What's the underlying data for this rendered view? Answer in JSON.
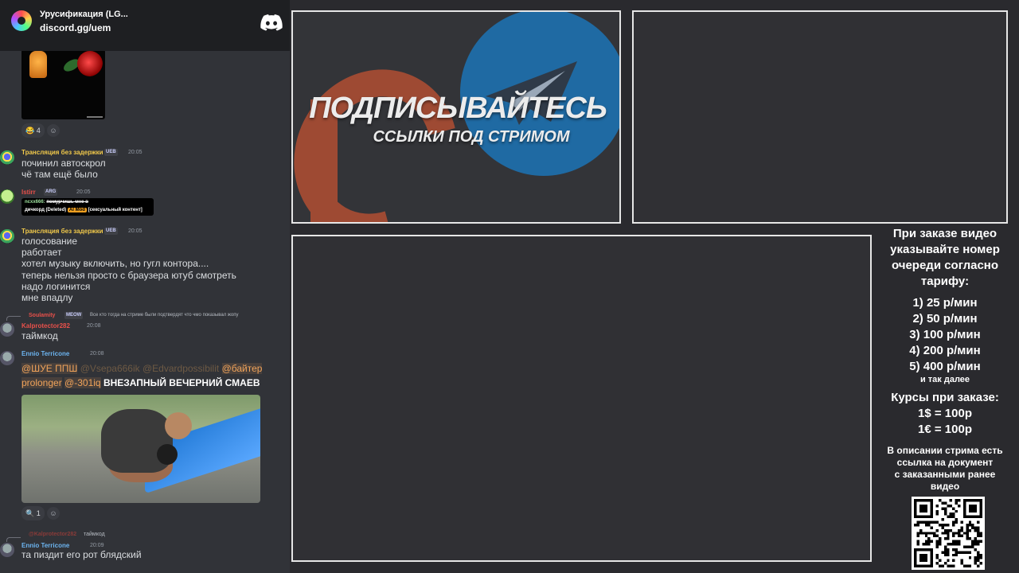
{
  "discord": {
    "server_name": "Урусификация (LG...",
    "invite": "discord.gg/uem",
    "reaction1": {
      "emoji": "😂",
      "count": "4"
    },
    "messages": [
      {
        "user": "Трансляция без задержки",
        "tag": "UEB",
        "time": "20:05",
        "lines": [
          "починил автоскрол",
          "чё там ещё было"
        ]
      },
      {
        "user": "lstirr",
        "tag": "ARG",
        "time": "20:05",
        "embed_user": "ncxx666:",
        "embed_text": "помурчишь мне в",
        "embed_line2a": "дичкорд (Deleted)",
        "embed_badge": "AI Mod",
        "embed_line2b": "[сексуальный контент]"
      },
      {
        "user": "Трансляция без задержки",
        "tag": "UEB",
        "time": "20:05",
        "lines": [
          "голосование",
          "работает",
          "хотел музыку включить, но гугл контора....",
          "теперь нельзя просто с браузера ютуб смотреть",
          "надо логинится",
          "мне впадлу"
        ]
      },
      {
        "reply_user": "Soulamity",
        "reply_tag": "MEOW",
        "reply_text": "Все кто тогда на стриме были подтвердят что чмо показывал жопу",
        "user": "Kalprotector282",
        "time": "20:08",
        "lines": [
          "таймкод"
        ]
      },
      {
        "user": "Ennio Terricone",
        "time": "20:08",
        "mention1": "@ШУЕ ППШ",
        "mention_dim1": "@Vsepa666ik",
        "mention_dim2": "@Edvardpossibilit",
        "mention2": "@байтер",
        "mention3": "prolonger",
        "mention4": "@-301iq",
        "caps": "ВНЕЗАПНЫЙ ВЕЧЕРНИЙ СМАЕВ"
      },
      {
        "reply_user": "@Kalprotector282",
        "reply_text": "таймкод",
        "user": "Ennio Terricone",
        "time": "20:09",
        "lines": [
          "та пиздит его рот блядский"
        ]
      }
    ],
    "reaction2": {
      "emoji": "🔍",
      "count": "1"
    }
  },
  "promo": {
    "title": "ПОДПИСЫВАЙТЕСЬ",
    "subtitle": "ССЫЛКИ ПОД СТРИМОМ"
  },
  "info": {
    "header_lines": [
      "При заказе видео",
      "указывайте номер",
      "очереди согласно",
      "тарифу:"
    ],
    "prices": [
      "1) 25 р/мин",
      "2) 50 р/мин",
      "3) 100 р/мин",
      "4) 200 р/мин",
      "5) 400 р/мин"
    ],
    "etc": "и так далее",
    "rates_title": "Курсы при заказе:",
    "rates": [
      "1$ = 100р",
      "1€ = 100р"
    ],
    "note_lines": [
      "В описании стрима есть",
      "ссылка на документ",
      "с заказанными ранее",
      "видео"
    ]
  },
  "colors": {
    "username_yellow": "#f0c84a",
    "username_red": "#e8504a",
    "username_blue": "#6cb4f0",
    "mention": "#f0a35a",
    "telegram": "#1f6aa3",
    "patreon": "#9e4a33"
  }
}
